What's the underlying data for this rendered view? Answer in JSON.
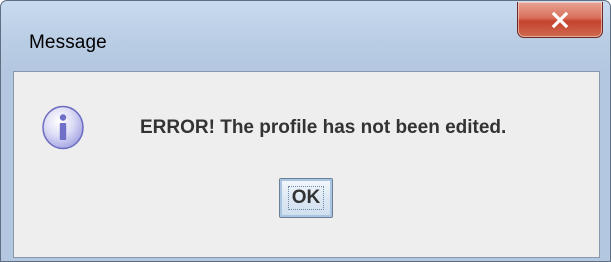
{
  "window": {
    "title": "Message"
  },
  "titlebar": {
    "close_icon": "close-x-icon"
  },
  "dialog": {
    "icon": "information-icon",
    "message": "ERROR! The profile has not been edited.",
    "ok_label": "OK"
  },
  "colors": {
    "close_button": "#c4432d",
    "client_background": "#eeeeee",
    "frame": "#b3c8e0"
  }
}
